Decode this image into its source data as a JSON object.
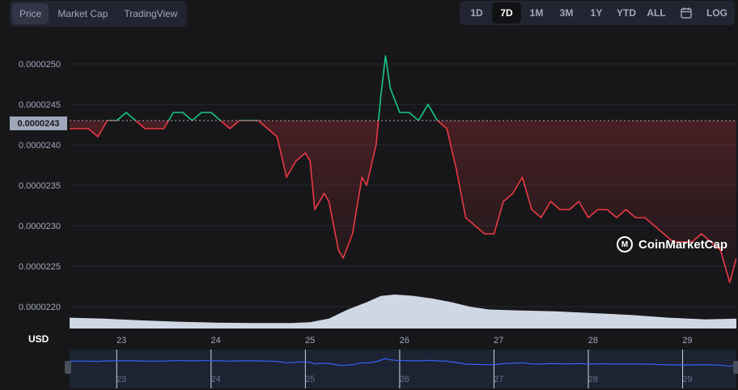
{
  "tabs": [
    {
      "label": "Price",
      "active": true
    },
    {
      "label": "Market Cap",
      "active": false
    },
    {
      "label": "TradingView",
      "active": false
    }
  ],
  "ranges": [
    {
      "label": "1D",
      "active": false
    },
    {
      "label": "7D",
      "active": true
    },
    {
      "label": "1M",
      "active": false
    },
    {
      "label": "3M",
      "active": false
    },
    {
      "label": "1Y",
      "active": false
    },
    {
      "label": "YTD",
      "active": false
    },
    {
      "label": "ALL",
      "active": false
    },
    {
      "label": "",
      "icon": "calendar-icon",
      "active": false
    },
    {
      "label": "LOG",
      "active": false
    }
  ],
  "current_price": "0.0000243",
  "currency_label": "USD",
  "watermark": "CoinMarketCap",
  "colors": {
    "up": "#16c784",
    "down": "#ea3943",
    "background": "#17171a",
    "volume": "#cfd6e4",
    "navigator_line": "#3861fb"
  },
  "chart_data": {
    "type": "line",
    "title": "",
    "xlabel": "",
    "ylabel": "",
    "x_ticks": [
      "23",
      "24",
      "25",
      "26",
      "27",
      "28",
      "29"
    ],
    "y_ticks": [
      "0.0000250",
      "0.0000245",
      "0.0000240",
      "0.0000235",
      "0.0000230",
      "0.0000225",
      "0.0000220"
    ],
    "ylim": [
      2.18e-05,
      2.53e-05
    ],
    "xlim": [
      22.45,
      29.52
    ],
    "baseline": 2.43e-05,
    "series": [
      {
        "x": [
          22.45,
          22.55,
          22.65,
          22.75,
          22.85,
          22.95,
          23.05,
          23.15,
          23.25,
          23.35,
          23.45,
          23.55,
          23.65,
          23.75,
          23.85,
          23.95,
          24.05,
          24.15,
          24.25,
          24.35,
          24.45,
          24.55,
          24.65,
          24.75,
          24.85,
          24.95,
          25.0,
          25.05,
          25.15,
          25.2,
          25.3,
          25.35,
          25.45,
          25.55,
          25.6,
          25.7,
          25.75,
          25.8,
          25.85,
          25.95,
          26.05,
          26.15,
          26.25,
          26.35,
          26.45,
          26.55,
          26.6,
          26.65,
          26.75,
          26.85,
          26.95,
          27.05,
          27.15,
          27.25,
          27.35,
          27.45,
          27.55,
          27.65,
          27.75,
          27.85,
          27.95,
          28.05,
          28.15,
          28.25,
          28.35,
          28.45,
          28.55,
          28.65,
          28.75,
          28.85,
          28.95,
          29.05,
          29.15,
          29.25,
          29.35,
          29.45,
          29.52
        ],
        "values": [
          2.42e-05,
          2.42e-05,
          2.42e-05,
          2.41e-05,
          2.43e-05,
          2.43e-05,
          2.44e-05,
          2.43e-05,
          2.42e-05,
          2.42e-05,
          2.42e-05,
          2.44e-05,
          2.44e-05,
          2.43e-05,
          2.44e-05,
          2.44e-05,
          2.43e-05,
          2.42e-05,
          2.43e-05,
          2.43e-05,
          2.43e-05,
          2.42e-05,
          2.41e-05,
          2.36e-05,
          2.38e-05,
          2.39e-05,
          2.38e-05,
          2.32e-05,
          2.34e-05,
          2.33e-05,
          2.27e-05,
          2.26e-05,
          2.29e-05,
          2.36e-05,
          2.35e-05,
          2.4e-05,
          2.46e-05,
          2.51e-05,
          2.47e-05,
          2.44e-05,
          2.44e-05,
          2.43e-05,
          2.45e-05,
          2.43e-05,
          2.42e-05,
          2.37e-05,
          2.34e-05,
          2.31e-05,
          2.3e-05,
          2.29e-05,
          2.29e-05,
          2.33e-05,
          2.34e-05,
          2.36e-05,
          2.32e-05,
          2.31e-05,
          2.33e-05,
          2.32e-05,
          2.32e-05,
          2.33e-05,
          2.31e-05,
          2.32e-05,
          2.32e-05,
          2.31e-05,
          2.32e-05,
          2.31e-05,
          2.31e-05,
          2.3e-05,
          2.29e-05,
          2.28e-05,
          2.28e-05,
          2.28e-05,
          2.29e-05,
          2.28e-05,
          2.27e-05,
          2.23e-05,
          2.26e-05
        ]
      }
    ],
    "volume": {
      "x": [
        22.45,
        22.8,
        23.2,
        23.6,
        24.0,
        24.4,
        24.8,
        25.0,
        25.2,
        25.4,
        25.6,
        25.75,
        25.9,
        26.1,
        26.3,
        26.5,
        26.7,
        26.9,
        27.2,
        27.6,
        28.0,
        28.4,
        28.8,
        29.2,
        29.52
      ],
      "values": [
        0.24,
        0.22,
        0.18,
        0.15,
        0.13,
        0.12,
        0.12,
        0.14,
        0.22,
        0.42,
        0.58,
        0.72,
        0.75,
        0.72,
        0.66,
        0.58,
        0.48,
        0.42,
        0.4,
        0.38,
        0.34,
        0.3,
        0.24,
        0.2,
        0.22
      ]
    }
  }
}
